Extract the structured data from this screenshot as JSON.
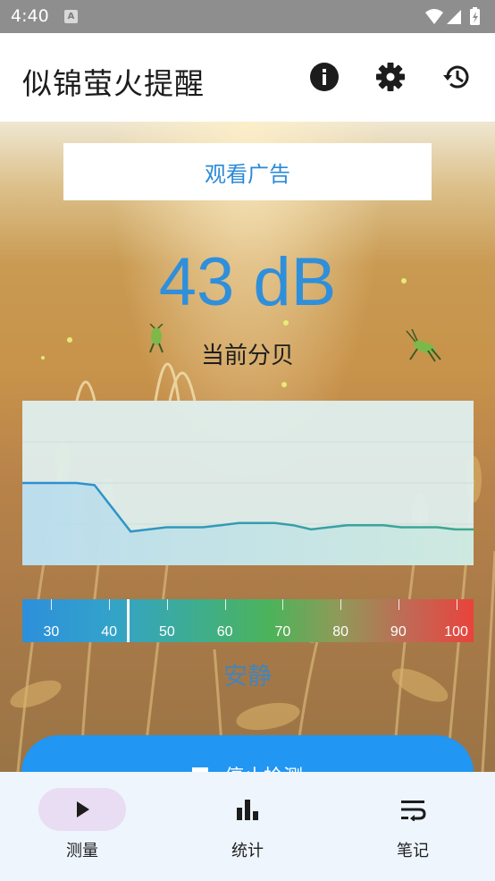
{
  "status_bar": {
    "time": "4:40",
    "notification": "A"
  },
  "app_bar": {
    "title": "似锦萤火提醒",
    "actions": [
      {
        "name": "info",
        "icon": "info-icon"
      },
      {
        "name": "settings",
        "icon": "gear-icon"
      },
      {
        "name": "history",
        "icon": "history-icon"
      }
    ]
  },
  "ad_button": {
    "label": "观看广告"
  },
  "meter": {
    "reading": "43 dB",
    "label": "当前分贝",
    "level": "安静",
    "current_db": 43,
    "scale_min": 25,
    "scale_max": 103
  },
  "scale": {
    "ticks": [
      "30",
      "40",
      "50",
      "60",
      "70",
      "80",
      "90",
      "100"
    ]
  },
  "chart_data": {
    "type": "area",
    "y_range": [
      25,
      103
    ],
    "values": [
      64,
      64,
      64,
      64,
      63,
      52,
      41,
      42,
      43,
      43,
      43,
      44,
      45,
      45,
      45,
      44,
      42,
      43,
      44,
      44,
      44,
      43,
      43,
      43,
      42,
      42
    ],
    "colors": {
      "line_start": "#2b8fd6",
      "line_end": "#3fa98c",
      "fill_start": "#b7dcee",
      "fill_end": "#cbe9df"
    },
    "grid": true
  },
  "stop_button": {
    "label": "停止检测"
  },
  "bottom_nav": {
    "items": [
      {
        "label": "测量",
        "icon": "play-icon",
        "active": true
      },
      {
        "label": "统计",
        "icon": "bar-chart-icon",
        "active": false
      },
      {
        "label": "笔记",
        "icon": "wrap-text-icon",
        "active": false
      }
    ]
  }
}
